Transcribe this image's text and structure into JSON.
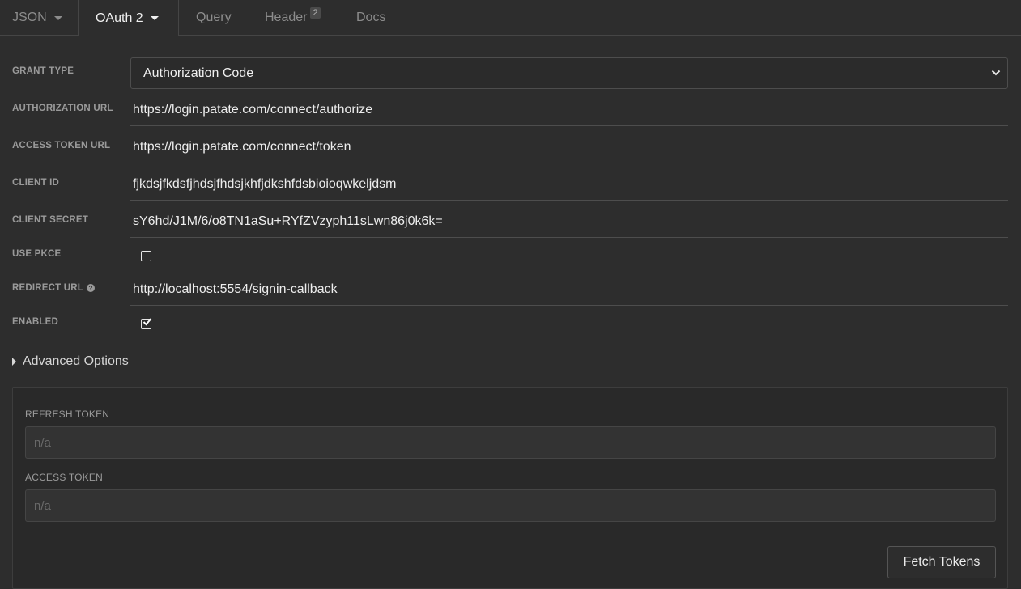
{
  "tabs": {
    "body": "JSON",
    "auth": "OAuth 2",
    "query": "Query",
    "header": "Header",
    "header_badge": "2",
    "docs": "Docs"
  },
  "form": {
    "grant_type": {
      "label": "GRANT TYPE",
      "value": "Authorization Code"
    },
    "authorization_url": {
      "label": "AUTHORIZATION URL",
      "value": "https://login.patate.com/connect/authorize"
    },
    "access_token_url": {
      "label": "ACCESS TOKEN URL",
      "value": "https://login.patate.com/connect/token"
    },
    "client_id": {
      "label": "CLIENT ID",
      "value": "fjkdsjfkdsfjhdsjfhdsjkhfjdkshfdsbioioqwkeljdsm"
    },
    "client_secret": {
      "label": "CLIENT SECRET",
      "value": "sY6hd/J1M/6/o8TN1aSu+RYfZVzyph11sLwn86j0k6k="
    },
    "use_pkce": {
      "label": "USE PKCE",
      "checked": false
    },
    "redirect_url": {
      "label": "REDIRECT URL",
      "value": "http://localhost:5554/signin-callback"
    },
    "enabled": {
      "label": "ENABLED",
      "checked": true
    }
  },
  "advanced": {
    "label": "Advanced Options"
  },
  "tokens": {
    "refresh_label": "REFRESH TOKEN",
    "refresh_placeholder": "n/a",
    "access_label": "ACCESS TOKEN",
    "access_placeholder": "n/a",
    "fetch_button": "Fetch Tokens"
  },
  "icons": {
    "help": "question-circle-icon",
    "dropdown": "chevron-down-icon",
    "check": "check-icon"
  }
}
